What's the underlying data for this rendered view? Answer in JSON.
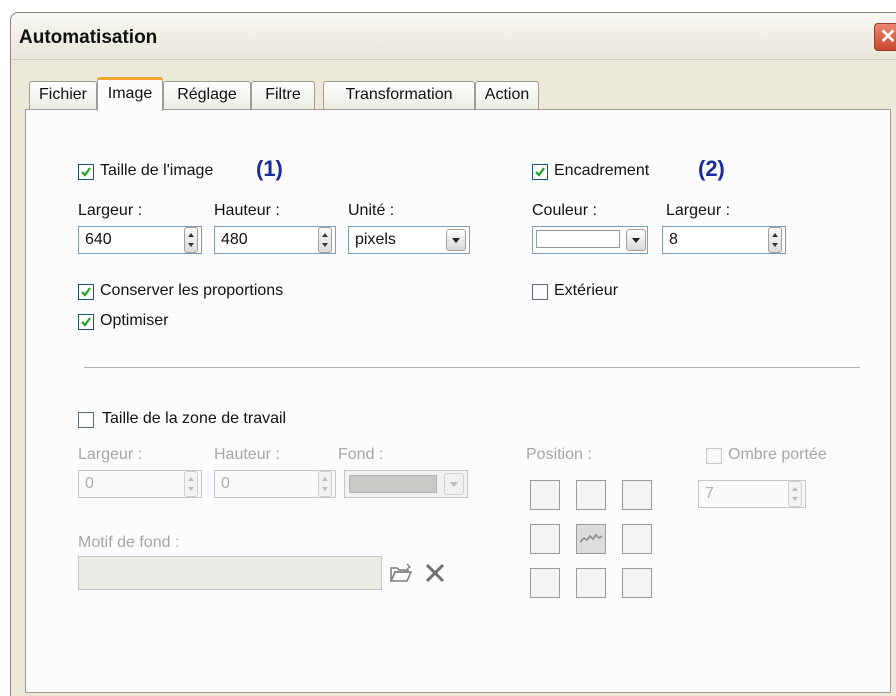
{
  "window": {
    "title": "Automatisation",
    "close_glyph": "✕"
  },
  "tabs": [
    {
      "label": "Fichier"
    },
    {
      "label": "Image"
    },
    {
      "label": "Réglage"
    },
    {
      "label": "Filtre"
    },
    {
      "label": "Transformation"
    },
    {
      "label": "Action"
    }
  ],
  "active_tab": "Image",
  "image_size": {
    "label": "Taille de l'image",
    "checked": true,
    "marker": "(1)",
    "width_label": "Largeur :",
    "width_value": "640",
    "height_label": "Hauteur :",
    "height_value": "480",
    "unit_label": "Unité :",
    "unit_value": "pixels",
    "keep_ratio_label": "Conserver les proportions",
    "keep_ratio_checked": true,
    "optimize_label": "Optimiser",
    "optimize_checked": true
  },
  "frame": {
    "label": "Encadrement",
    "checked": true,
    "marker": "(2)",
    "color_label": "Couleur :",
    "color_value": "#ffffff",
    "width_label": "Largeur :",
    "width_value": "8",
    "outside_label": "Extérieur",
    "outside_checked": false
  },
  "canvas": {
    "label": "Taille de la zone de travail",
    "checked": false,
    "width_label": "Largeur :",
    "width_value": "0",
    "height_label": "Hauteur :",
    "height_value": "0",
    "background_label": "Fond :",
    "pattern_label": "Motif de fond :",
    "pattern_value": "",
    "position_label": "Position :",
    "shadow_label": "Ombre portée",
    "shadow_checked": false,
    "shadow_value": "7"
  },
  "icons": {
    "browse": "folder-open-icon",
    "clear": "clear-x-icon"
  },
  "colors": {
    "accent_tab": "#f3a52d",
    "marker": "#1c2b9c",
    "check": "#21a121"
  }
}
